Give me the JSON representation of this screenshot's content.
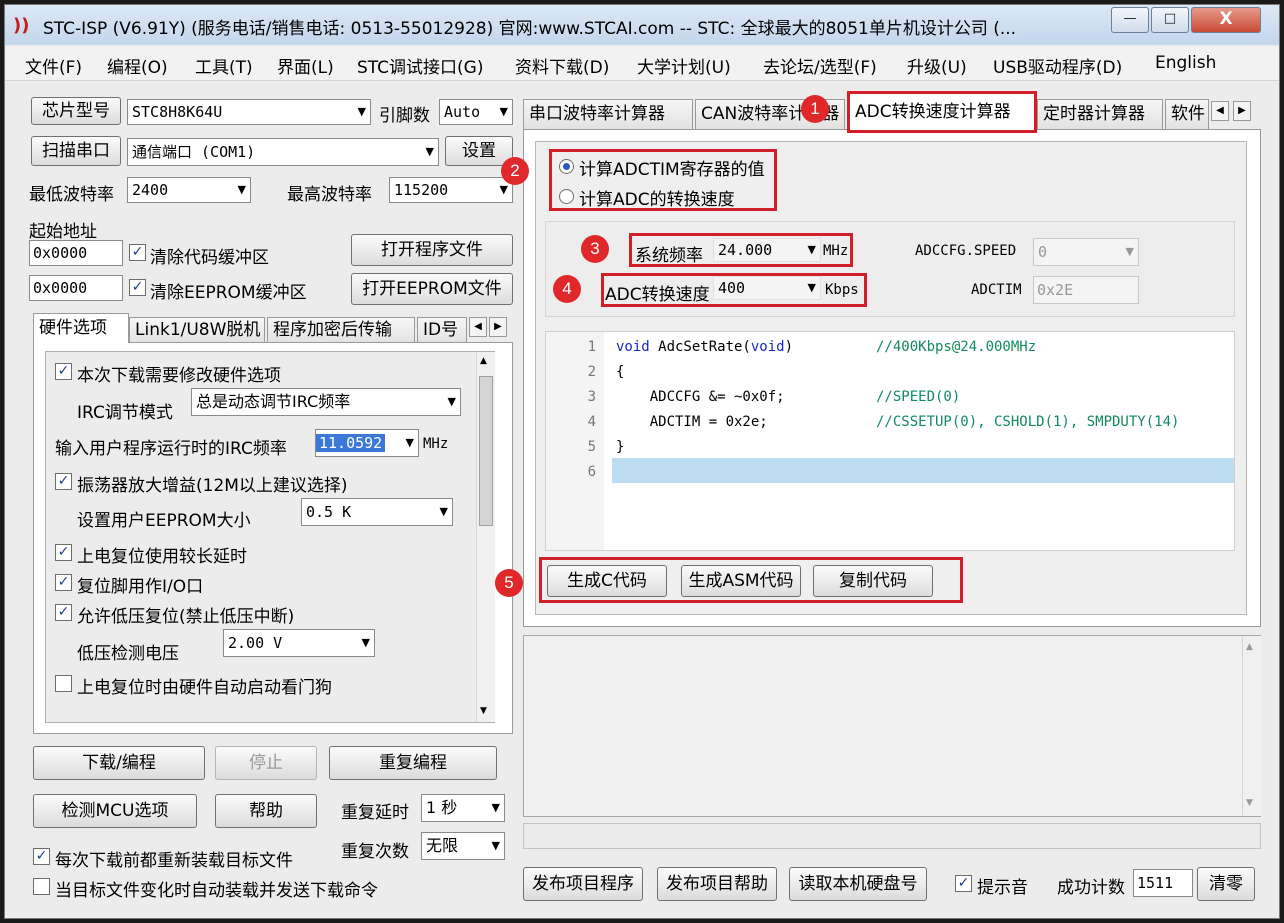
{
  "window": {
    "title": "STC-ISP (V6.91Y) (服务电话/销售电话: 0513-55012928) 官网:www.STCAI.com  -- STC: 全球最大的8051单片机设计公司 (...",
    "minimize": "—",
    "maximize": "□",
    "close": "X"
  },
  "menu": [
    "文件(F)",
    "编程(O)",
    "工具(T)",
    "界面(L)",
    "STC调试接口(G)",
    "资料下载(D)",
    "大学计划(U)",
    "去论坛/选型(F)",
    "升级(U)",
    "USB驱动程序(D)",
    "English"
  ],
  "left": {
    "chip_btn": "芯片型号",
    "chip_value": "STC8H8K64U",
    "pins_label": "引脚数",
    "pins_value": "Auto",
    "scan_btn": "扫描串口",
    "port_value": "通信端口 (COM1)",
    "settings_btn": "设置",
    "min_baud_label": "最低波特率",
    "min_baud_value": "2400",
    "max_baud_label": "最高波特率",
    "max_baud_value": "115200",
    "start_addr_label": "起始地址",
    "addr1": "0x0000",
    "clear_code": "清除代码缓冲区",
    "open_prog_btn": "打开程序文件",
    "addr2": "0x0000",
    "clear_eeprom": "清除EEPROM缓冲区",
    "open_eeprom_btn": "打开EEPROM文件",
    "tabs": [
      "硬件选项",
      "Link1/U8W脱机",
      "程序加密后传输",
      "ID号"
    ],
    "hw": {
      "opt1": "本次下载需要修改硬件选项",
      "irc_mode_label": "IRC调节模式",
      "irc_mode_value": "总是动态调节IRC频率",
      "irc_freq_label": "输入用户程序运行时的IRC频率",
      "irc_freq_value": "11.0592",
      "irc_freq_unit": "MHz",
      "opt2": "振荡器放大增益(12M以上建议选择)",
      "eeprom_label": "设置用户EEPROM大小",
      "eeprom_value": "0.5 K",
      "opt3": "上电复位使用较长延时",
      "opt4": "复位脚用作I/O口",
      "opt5": "允许低压复位(禁止低压中断)",
      "lv_label": "低压检测电压",
      "lv_value": "2.00 V",
      "opt6": "上电复位时由硬件自动启动看门狗"
    },
    "download_btn": "下载/编程",
    "stop_btn": "停止",
    "reprogram_btn": "重复编程",
    "detect_btn": "检测MCU选项",
    "help_btn": "帮助",
    "repeat_delay_label": "重复延时",
    "repeat_delay_value": "1 秒",
    "repeat_count_label": "重复次数",
    "repeat_count_value": "无限",
    "reload_label": "每次下载前都重新装载目标文件",
    "auto_label": "当目标文件变化时自动装载并发送下载命令"
  },
  "right": {
    "tabs": [
      "串口波特率计算器",
      "CAN波特率计算器",
      "ADC转换速度计算器",
      "定时器计算器",
      "软件"
    ],
    "radio1": "计算ADCTIM寄存器的值",
    "radio2": "计算ADC的转换速度",
    "sysfreq_label": "系统频率",
    "sysfreq_value": "24.000",
    "sysfreq_unit": "MHz",
    "adccfg_label": "ADCCFG.SPEED",
    "adccfg_value": "0",
    "adcspeed_label": "ADC转换速度",
    "adcspeed_value": "400",
    "adcspeed_unit": "Kbps",
    "adctim_label": "ADCTIM",
    "adctim_value": "0x2E",
    "code_lines": [
      {
        "n": "1",
        "code": "void AdcSetRate(void)",
        "comment": "//400Kbps@24.000MHz"
      },
      {
        "n": "2",
        "code": "{",
        "comment": ""
      },
      {
        "n": "3",
        "code": "    ADCCFG &= ~0x0f;",
        "comment": "//SPEED(0)"
      },
      {
        "n": "4",
        "code": "    ADCTIM = 0x2e;",
        "comment": "//CSSETUP(0), CSHOLD(1), SMPDUTY(14)"
      },
      {
        "n": "5",
        "code": "}",
        "comment": ""
      },
      {
        "n": "6",
        "code": "",
        "comment": ""
      }
    ],
    "gen_c_btn": "生成C代码",
    "gen_asm_btn": "生成ASM代码",
    "copy_btn": "复制代码",
    "publish_prog_btn": "发布项目程序",
    "publish_help_btn": "发布项目帮助",
    "read_disk_btn": "读取本机硬盘号",
    "sound_label": "提示音",
    "success_label": "成功计数",
    "success_value": "1511",
    "clear_btn": "清零"
  },
  "badges": [
    "1",
    "2",
    "3",
    "4",
    "5"
  ]
}
